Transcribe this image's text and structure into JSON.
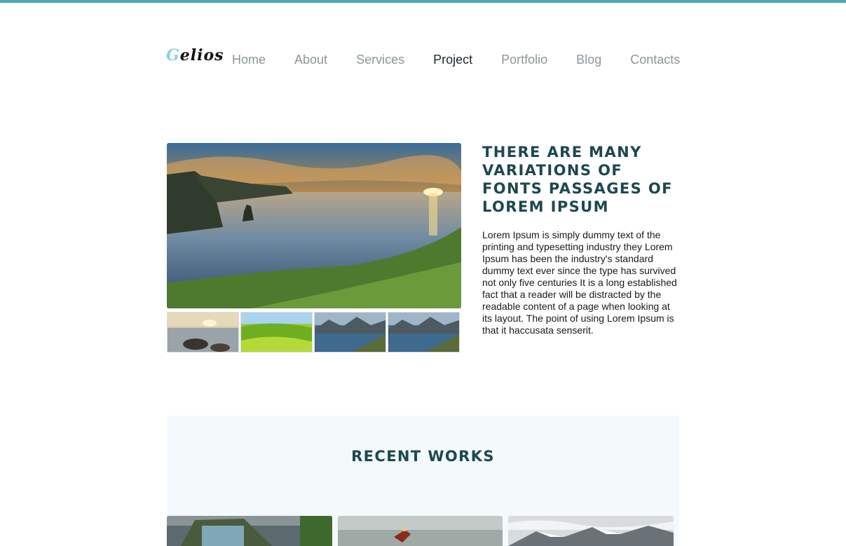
{
  "header": {
    "logo_first": "G",
    "logo_rest": "elios",
    "nav": [
      {
        "label": "Home",
        "active": false
      },
      {
        "label": "About",
        "active": false
      },
      {
        "label": "Services",
        "active": false
      },
      {
        "label": "Project",
        "active": true
      },
      {
        "label": "Portfolio",
        "active": false
      },
      {
        "label": "Blog",
        "active": false
      },
      {
        "label": "Contacts",
        "active": false
      }
    ]
  },
  "hero": {
    "image": "sea-cliffs-sunset",
    "thumbnails": [
      "rocky-shore-sunset",
      "green-hills",
      "mountain-lake",
      "mountain-lake"
    ],
    "title": "THERE ARE MANY VARIATIONS OF FONTS PASSAGES OF LOREM IPSUM",
    "text": "Lorem Ipsum is simply dummy text of the printing and typesetting industry they Lorem Ipsum has been the industry's standard dummy text ever since the type has survived not only five centuries It is a long established fact that a reader will be distracted by the readable content of a page when looking at its layout. The point of using Lorem Ipsum is that it haccusata senserit."
  },
  "recent_works": {
    "title": "RECENT WORKS",
    "items": [
      "building-storm",
      "motocross-rider",
      "snowy-mountains"
    ]
  },
  "colors": {
    "accent": "#4aa9b3",
    "heading": "#1c4850",
    "nav_text": "#8c969a",
    "nav_active": "#1c2a2e",
    "section_bg": "#f4fafc"
  }
}
